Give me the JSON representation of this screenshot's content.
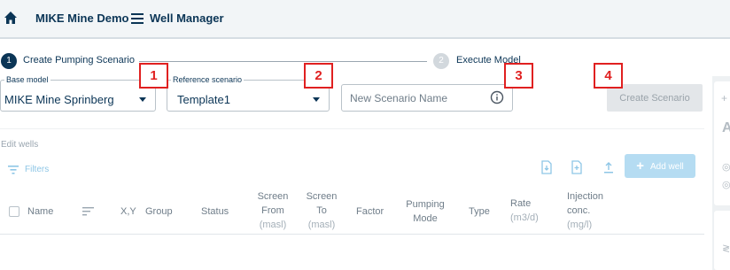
{
  "header": {
    "app_title": "MIKE Mine Demo",
    "page_title": "Well Manager"
  },
  "stepper": {
    "steps": [
      {
        "number": "1",
        "label": "Create Pumping Scenario",
        "state": "active"
      },
      {
        "number": "2",
        "label": "Execute Model",
        "state": "inactive"
      }
    ]
  },
  "form": {
    "base_model": {
      "label": "Base model",
      "value": "MIKE Mine Sprinberg"
    },
    "reference_scenario": {
      "label": "Reference scenario",
      "value": "Template1"
    },
    "scenario_name": {
      "placeholder": "New Scenario Name",
      "value": ""
    },
    "create_button": "Create Scenario"
  },
  "callouts": [
    "1",
    "2",
    "3",
    "4"
  ],
  "wells": {
    "title": "Edit wells",
    "filters_label": "Filters",
    "add_button": "Add well",
    "columns": [
      {
        "label": "Name"
      },
      {
        "label": "X,Y"
      },
      {
        "label": "Group"
      },
      {
        "label": "Status"
      },
      {
        "label": "Screen From",
        "unit": "(masl)"
      },
      {
        "label": "Screen To",
        "unit": "(masl)"
      },
      {
        "label": "Factor"
      },
      {
        "label": "Pumping Mode"
      },
      {
        "label": "Type"
      },
      {
        "label": "Rate",
        "unit": "(m3/d)"
      },
      {
        "label": "Injection conc.",
        "unit": "(mg/l)"
      }
    ],
    "rows": []
  },
  "colors": {
    "primary": "#0b3556",
    "accent_light": "#b5dcf2",
    "callout": "#e02020",
    "disabled": "#e3e6e9"
  },
  "icons": [
    "home-icon",
    "menu-icon",
    "info-icon",
    "filter-icon",
    "import-icon",
    "export-icon",
    "upload-icon",
    "sort-icon",
    "chevron-down-icon"
  ]
}
